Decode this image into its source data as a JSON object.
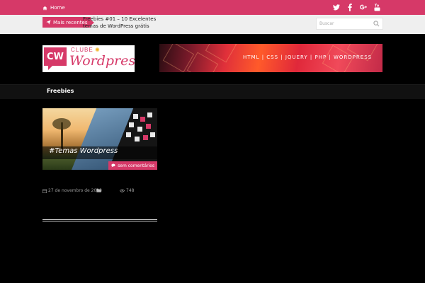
{
  "topbar": {
    "home_label": "Home",
    "home_icon": "home-icon",
    "social": [
      "twitter-icon",
      "facebook-icon",
      "google-plus-icon",
      "youtube-icon"
    ]
  },
  "ticker": {
    "recent_label": "Mais recentes",
    "recent_icon": "paper-plane-icon",
    "headline": "Freebies #01 – 10 Excelentes temas de WordPress grátis"
  },
  "search": {
    "placeholder": "Buscar"
  },
  "header": {
    "logo_mark": "CW",
    "logo_small": "CLUBE",
    "logo_main": "Wordpress",
    "banner_text": "HTML | CSS | JQUERY | PHP | WORDPRESS"
  },
  "nav": {
    "items": [
      {
        "label": "Freebies"
      }
    ]
  },
  "post": {
    "image_title": "#Temas Wordpress",
    "comments_label": "sem comentários",
    "date": "27 de novembro de 2013",
    "views": "748"
  },
  "colors": {
    "accent": "#d63968",
    "ticker_bg": "#efefef",
    "nav_bg": "#111111",
    "page_bg": "#000000"
  }
}
